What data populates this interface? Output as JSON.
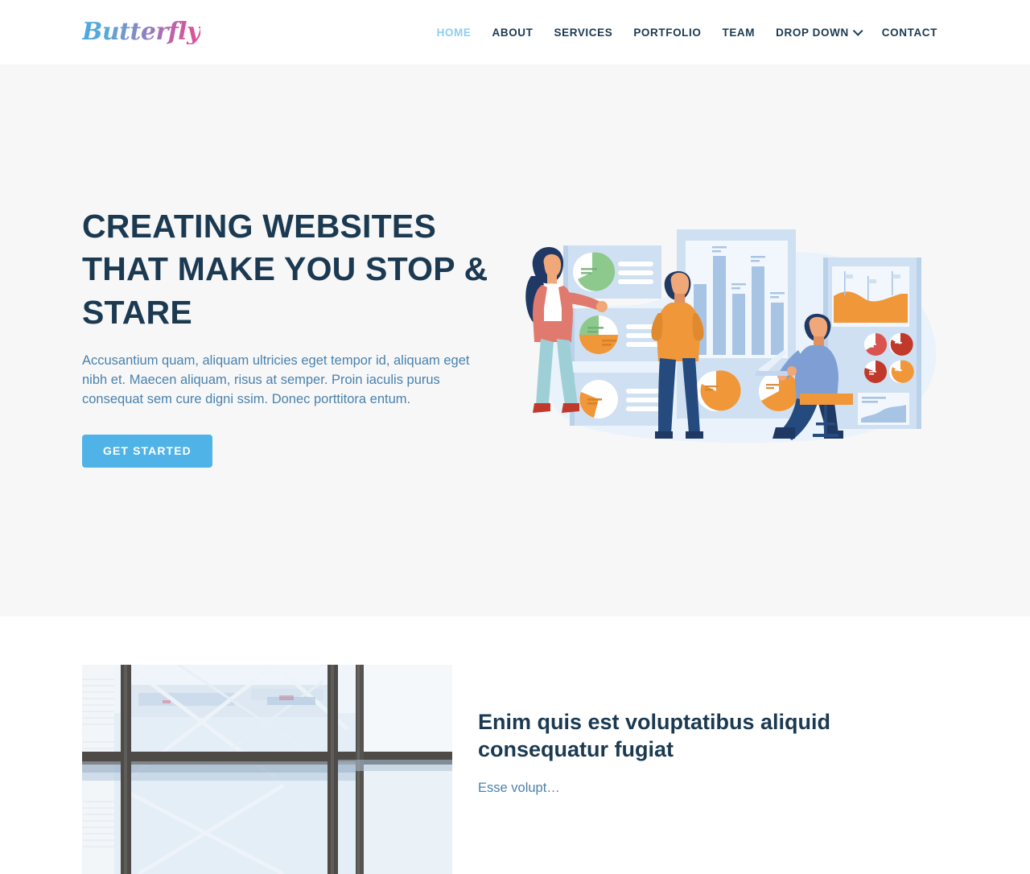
{
  "header": {
    "logo_text": "Butterfly",
    "nav": [
      {
        "label": "HOME",
        "active": true,
        "icon": null
      },
      {
        "label": "ABOUT",
        "active": false,
        "icon": null
      },
      {
        "label": "SERVICES",
        "active": false,
        "icon": null
      },
      {
        "label": "PORTFOLIO",
        "active": false,
        "icon": null
      },
      {
        "label": "TEAM",
        "active": false,
        "icon": null
      },
      {
        "label": "DROP DOWN",
        "active": false,
        "icon": "chevron-down-icon"
      },
      {
        "label": "CONTACT",
        "active": false,
        "icon": null
      }
    ]
  },
  "hero": {
    "title": "CREATING WEBSITES THAT MAKE YOU STOP & STARE",
    "description": "Accusantium quam, aliquam ultricies eget tempor id, aliquam eget nibh et. Maecen aliquam, risus at semper. Proin iaculis purus consequat sem cure digni ssim. Donec porttitora entum.",
    "cta_label": "GET STARTED",
    "illustration_name": "business-analytics-illustration"
  },
  "about": {
    "image_name": "glass-building-facade-photo",
    "title": "Enim quis est voluptatibus aliquid consequatur fugiat",
    "description": "Esse volupt…"
  },
  "colors": {
    "accent_blue": "#4fb3e8",
    "nav_active": "#8ecdf2",
    "heading_navy": "#1b3a52",
    "body_blue": "#4a82ad",
    "hero_bg": "#f7f7f8",
    "header_bg": "#ffffff",
    "illustration_orange": "#f0973a",
    "illustration_coral": "#e07a6e",
    "illustration_lightblue": "#a8c4e5",
    "illustration_navy": "#254a7d",
    "illustration_green": "#8dc98d",
    "illustration_red": "#d9534f"
  }
}
